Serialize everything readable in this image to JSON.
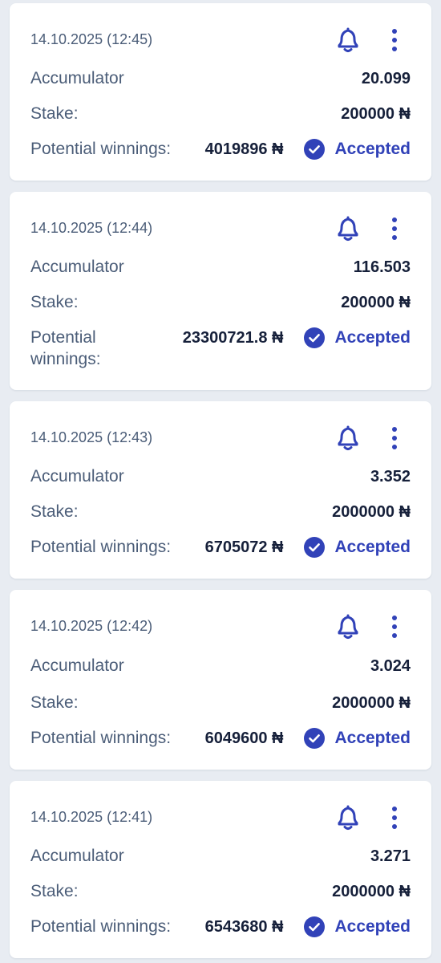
{
  "colors": {
    "page_background": "#e8ecf2",
    "card_background": "#ffffff",
    "label_text": "#4b5d78",
    "value_text": "#16203a",
    "accent_blue": "#3142b8"
  },
  "icons": {
    "bell": "bell-icon",
    "more": "vertical-dots-icon",
    "status": "check-circle-icon"
  },
  "bets": [
    {
      "timestamp": "14.10.2025 (12:45)",
      "type": "Accumulator",
      "odds": "20.099",
      "stake_label": "Stake:",
      "stake": "200000 ₦",
      "winnings_label": "Potential winnings:",
      "winnings": "4019896 ₦",
      "status": "Accepted"
    },
    {
      "timestamp": "14.10.2025 (12:44)",
      "type": "Accumulator",
      "odds": "116.503",
      "stake_label": "Stake:",
      "stake": "200000 ₦",
      "winnings_label": "Potential winnings:",
      "winnings": "23300721.8 ₦",
      "status": "Accepted"
    },
    {
      "timestamp": "14.10.2025 (12:43)",
      "type": "Accumulator",
      "odds": "3.352",
      "stake_label": "Stake:",
      "stake": "2000000 ₦",
      "winnings_label": "Potential winnings:",
      "winnings": "6705072 ₦",
      "status": "Accepted"
    },
    {
      "timestamp": "14.10.2025 (12:42)",
      "type": "Accumulator",
      "odds": "3.024",
      "stake_label": "Stake:",
      "stake": "2000000 ₦",
      "winnings_label": "Potential winnings:",
      "winnings": "6049600 ₦",
      "status": "Accepted"
    },
    {
      "timestamp": "14.10.2025 (12:41)",
      "type": "Accumulator",
      "odds": "3.271",
      "stake_label": "Stake:",
      "stake": "2000000 ₦",
      "winnings_label": "Potential winnings:",
      "winnings": "6543680 ₦",
      "status": "Accepted"
    }
  ]
}
